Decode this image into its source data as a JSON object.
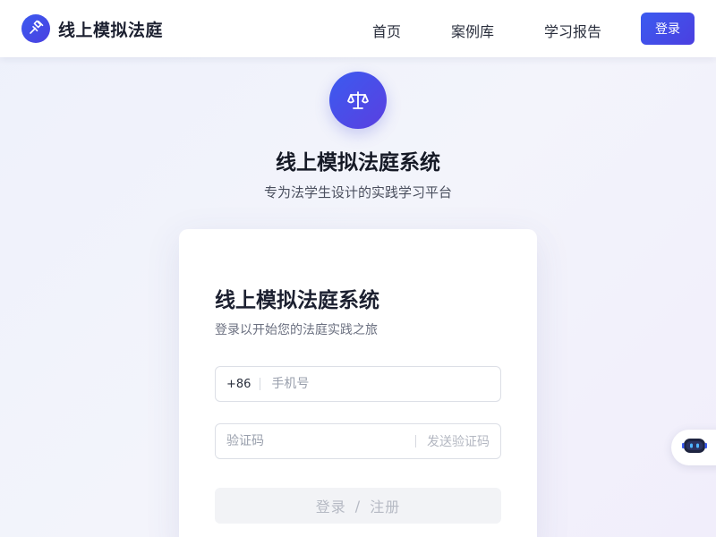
{
  "header": {
    "brand_name": "线上模拟法庭",
    "brand_icon": "gavel-icon",
    "nav": [
      {
        "label": "首页"
      },
      {
        "label": "案例库"
      },
      {
        "label": "学习报告"
      }
    ],
    "login_label": "登录"
  },
  "hero": {
    "icon": "scales-icon",
    "title": "线上模拟法庭系统",
    "subtitle": "专为法学生设计的实践学习平台"
  },
  "login_card": {
    "title": "线上模拟法庭系统",
    "subtitle": "登录以开始您的法庭实践之旅",
    "phone": {
      "prefix": "+86",
      "placeholder": "手机号",
      "value": ""
    },
    "code": {
      "placeholder": "验证码",
      "value": "",
      "send_label": "发送验证码"
    },
    "submit": {
      "login": "登录",
      "separator": "/",
      "register": "注册"
    }
  },
  "assistant": {
    "icon": "robot-icon"
  },
  "colors": {
    "accent": "#3b5bf0",
    "accent_end": "#4b3fe0",
    "disabled_bg": "#f2f3f6",
    "disabled_text": "#b6bac4"
  }
}
